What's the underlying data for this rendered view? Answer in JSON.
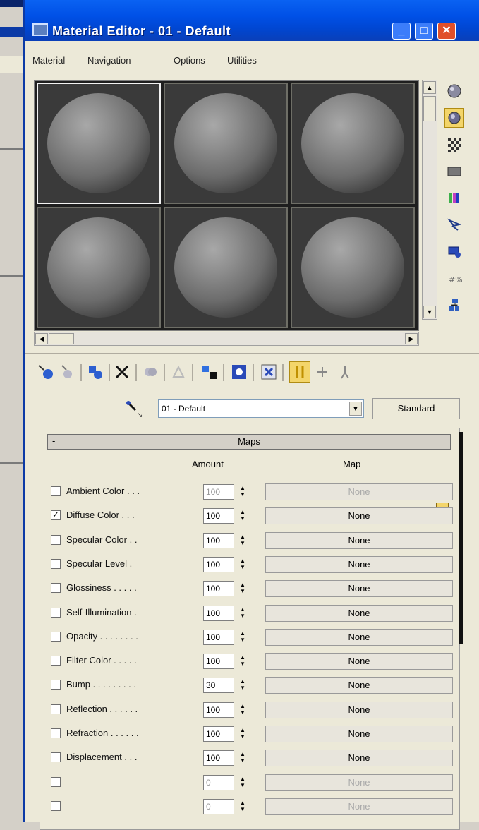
{
  "window": {
    "title": "Material Editor - 01 - Default",
    "menu": [
      "Material",
      "Navigation",
      "Options",
      "Utilities"
    ]
  },
  "sample_slots": [
    {
      "active": true
    },
    {
      "active": false
    },
    {
      "active": false
    },
    {
      "active": false
    },
    {
      "active": false
    },
    {
      "active": false
    }
  ],
  "side_toolbar": {
    "icons": [
      "sample-type-sphere-icon",
      "backlight-icon",
      "background-checker-icon",
      "uv-tiling-icon",
      "video-color-check-icon",
      "make-preview-icon",
      "options-icon",
      "select-by-material-icon",
      "material-navigator-icon"
    ]
  },
  "toolbar": {
    "icons": [
      "get-material-icon",
      "put-to-scene-icon",
      "assign-to-selection-icon",
      "reset-map-icon",
      "make-unique-icon",
      "put-to-library-icon",
      "material-id-channel-icon",
      "show-map-in-viewport-icon",
      "show-end-result-icon",
      "go-to-parent-icon",
      "go-forward-to-sibling-icon"
    ]
  },
  "material": {
    "name": "01 - Default",
    "type": "Standard"
  },
  "maps": {
    "title": "Maps",
    "collapse_symbol": "-",
    "header_amount": "Amount",
    "header_map": "Map",
    "rows": [
      {
        "label": "Ambient Color . . .",
        "checked": false,
        "amount": "100",
        "map": "None",
        "disabled": true
      },
      {
        "label": "Diffuse Color . . .",
        "checked": true,
        "amount": "100",
        "map": "None",
        "disabled": false
      },
      {
        "label": "Specular Color . .",
        "checked": false,
        "amount": "100",
        "map": "None",
        "disabled": false
      },
      {
        "label": "Specular Level .",
        "checked": false,
        "amount": "100",
        "map": "None",
        "disabled": false
      },
      {
        "label": "Glossiness . . . . .",
        "checked": false,
        "amount": "100",
        "map": "None",
        "disabled": false
      },
      {
        "label": "Self-Illumination .",
        "checked": false,
        "amount": "100",
        "map": "None",
        "disabled": false
      },
      {
        "label": "Opacity . . . . . . . .",
        "checked": false,
        "amount": "100",
        "map": "None",
        "disabled": false
      },
      {
        "label": "Filter Color . . . . .",
        "checked": false,
        "amount": "100",
        "map": "None",
        "disabled": false
      },
      {
        "label": "Bump . . . . . . . . .",
        "checked": false,
        "amount": "30",
        "map": "None",
        "disabled": false
      },
      {
        "label": "Reflection . . . . . .",
        "checked": false,
        "amount": "100",
        "map": "None",
        "disabled": false
      },
      {
        "label": "Refraction . . . . . .",
        "checked": false,
        "amount": "100",
        "map": "None",
        "disabled": false
      },
      {
        "label": "Displacement . . .",
        "checked": false,
        "amount": "100",
        "map": "None",
        "disabled": false
      },
      {
        "label": "",
        "checked": false,
        "amount": "0",
        "map": "None",
        "disabled": true
      },
      {
        "label": "",
        "checked": false,
        "amount": "0",
        "map": "None",
        "disabled": true
      }
    ]
  }
}
